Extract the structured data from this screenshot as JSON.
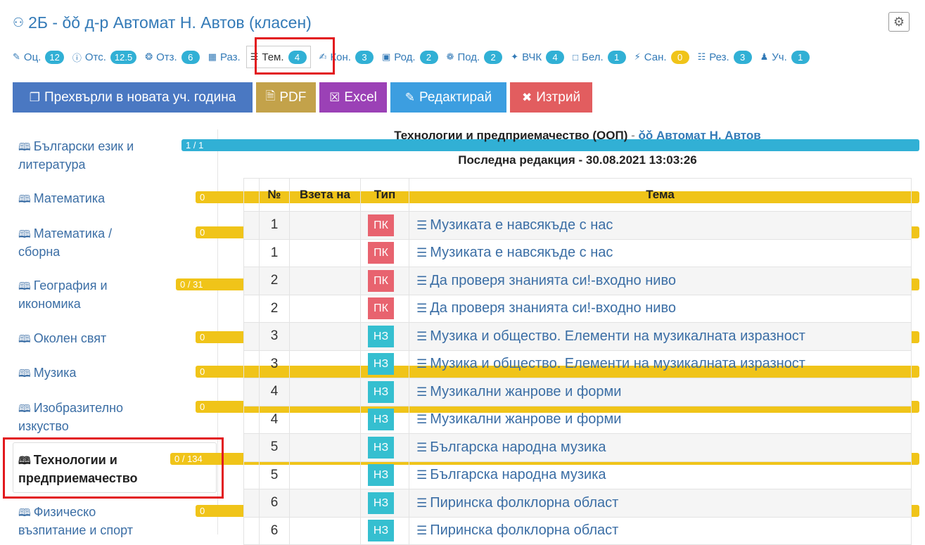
{
  "header": {
    "title": "2Б - ǒǒ д-р Автомат Н. Автов (класен)",
    "settings_icon": "gear-icon"
  },
  "tabs": [
    {
      "label": "Оц.",
      "count": "12",
      "icon": "pencil-icon"
    },
    {
      "label": "Отс.",
      "count": "12.5",
      "icon": "info-icon"
    },
    {
      "label": "Отз.",
      "count": "6",
      "icon": "award-icon"
    },
    {
      "label": "Раз.",
      "count": "",
      "icon": "table-icon"
    },
    {
      "label": "Тем.",
      "count": "4",
      "icon": "list-icon"
    },
    {
      "label": "Кон.",
      "count": "3",
      "icon": "edit-icon"
    },
    {
      "label": "Род.",
      "count": "2",
      "icon": "calendar-icon"
    },
    {
      "label": "Под.",
      "count": "2",
      "icon": "handshake-icon"
    },
    {
      "label": "ВЧК",
      "count": "4",
      "icon": "handshake-icon"
    },
    {
      "label": "Бел.",
      "count": "1",
      "icon": "note-icon"
    },
    {
      "label": "Сан.",
      "count": "0",
      "icon": "bolt-icon"
    },
    {
      "label": "Рез.",
      "count": "3",
      "icon": "document-icon"
    },
    {
      "label": "Уч.",
      "count": "1",
      "icon": "user-icon"
    }
  ],
  "actions": {
    "move": "Прехвърли в новата уч. година",
    "pdf": "PDF",
    "excel": "Excel",
    "edit": "Редактирай",
    "delete": "Изтрий"
  },
  "sidebar": {
    "items": [
      {
        "line1": "Български език и",
        "line2": "литература",
        "badge": "1 / 1",
        "color": "teal"
      },
      {
        "line1": "Математика",
        "line2": "",
        "badge": "0",
        "color": "yellow"
      },
      {
        "line1": "Математика /",
        "line2": "сборна",
        "badge": "0",
        "color": "yellow"
      },
      {
        "line1": "География и",
        "line2": "икономика",
        "badge": "0 / 31",
        "color": "yellow"
      },
      {
        "line1": "Околен свят",
        "line2": "",
        "badge": "0",
        "color": "yellow"
      },
      {
        "line1": "Музика",
        "line2": "",
        "badge": "0",
        "color": "yellow"
      },
      {
        "line1": "Изобразително",
        "line2": "изкуство",
        "badge": "0",
        "color": "yellow"
      },
      {
        "line1": "Технологии и",
        "line2": "предприемачество",
        "badge": "0 / 134",
        "color": "yellow"
      },
      {
        "line1": "Физическо",
        "line2": "възпитание и спорт",
        "badge": "0",
        "color": "yellow"
      }
    ]
  },
  "main": {
    "subject": "Технологии и предприемачество (ООП)",
    "separator": " - ",
    "teacher": "ǒǒ Автомат Н. Автов",
    "last_edit": "Последна редакция - 30.08.2021 13:03:26"
  },
  "table": {
    "headers": [
      "",
      "№",
      "Взета на",
      "Тип",
      "Тема"
    ],
    "rows": [
      {
        "n": "1",
        "type": "ПК",
        "topic": "Музиката е навсякъде с нас"
      },
      {
        "n": "1",
        "type": "ПК",
        "topic": "Музиката е навсякъде с нас"
      },
      {
        "n": "2",
        "type": "ПК",
        "topic": "Да проверя знанията си!-входно ниво"
      },
      {
        "n": "2",
        "type": "ПК",
        "topic": "Да проверя знанията си!-входно ниво"
      },
      {
        "n": "3",
        "type": "НЗ",
        "topic": "Музика и общество. Елементи на музикалната изразност"
      },
      {
        "n": "3",
        "type": "НЗ",
        "topic": "Музика и общество. Елементи на музикалната изразност"
      },
      {
        "n": "4",
        "type": "НЗ",
        "topic": "Музикални жанрове и форми"
      },
      {
        "n": "4",
        "type": "НЗ",
        "topic": "Музикални жанрове и форми"
      },
      {
        "n": "5",
        "type": "НЗ",
        "topic": "Българска народна музика"
      },
      {
        "n": "5",
        "type": "НЗ",
        "topic": "Българска народна музика"
      },
      {
        "n": "6",
        "type": "НЗ",
        "topic": "Пиринска фолклорна област"
      },
      {
        "n": "6",
        "type": "НЗ",
        "topic": "Пиринска фолклорна област"
      }
    ]
  },
  "colors": {
    "link": "#337ab7",
    "badge_teal": "#31b0d5",
    "badge_yellow": "#f0c419",
    "type_pk": "#e8636f",
    "type_nz": "#35bfd0",
    "highlight": "#e2191e"
  }
}
